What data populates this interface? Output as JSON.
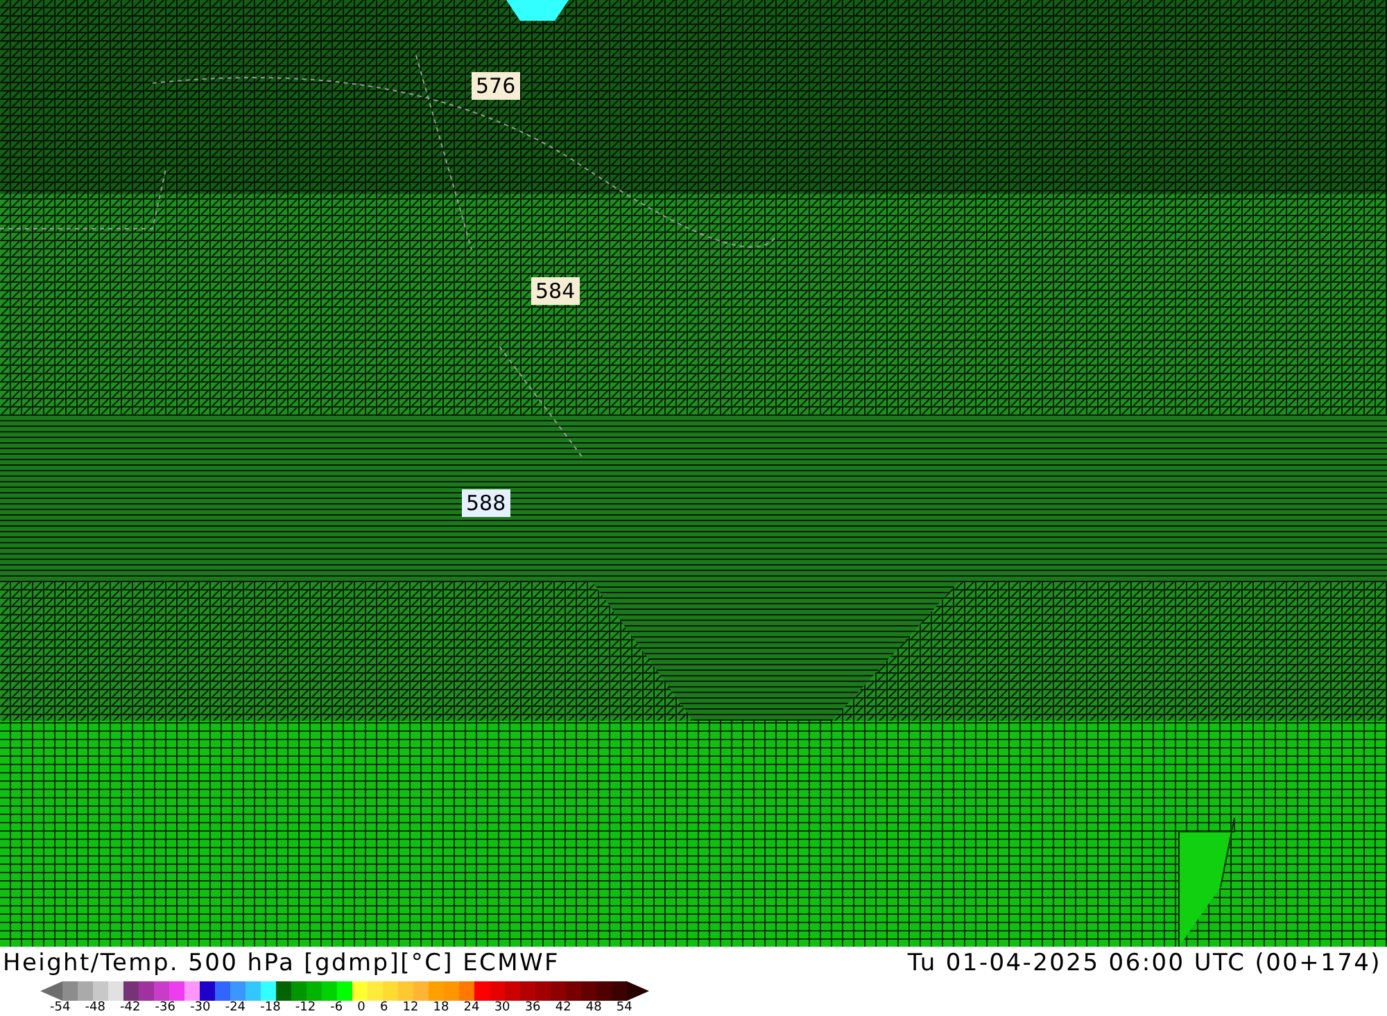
{
  "map": {
    "contour_labels": [
      {
        "text": "576",
        "color": "#f5eed5"
      },
      {
        "text": "584",
        "color": "#f5eed5"
      },
      {
        "text": "588",
        "color": "#e6f0ff"
      }
    ]
  },
  "title": "Height/Temp. 500 hPa [gdmp][°C] ECMWF",
  "valid_time": "Tu 01-04-2025 06:00 UTC (00+174)",
  "legend": {
    "swatches": [
      {
        "kind": "low",
        "color": "#6e6e6e"
      },
      {
        "color": "#8c8c8c"
      },
      {
        "color": "#aaaaaa"
      },
      {
        "color": "#c8c8c8"
      },
      {
        "color": "#e1e1e1"
      },
      {
        "color": "#783278"
      },
      {
        "color": "#a032a0"
      },
      {
        "color": "#c83cc8"
      },
      {
        "color": "#f03cf0"
      },
      {
        "color": "#ff96ff"
      },
      {
        "color": "#1e00c8"
      },
      {
        "color": "#3264ff"
      },
      {
        "color": "#3c96ff"
      },
      {
        "color": "#32c8ff"
      },
      {
        "color": "#32ffff"
      },
      {
        "color": "#006400"
      },
      {
        "color": "#009600"
      },
      {
        "color": "#00b400"
      },
      {
        "color": "#00d200"
      },
      {
        "color": "#00ff00"
      },
      {
        "color": "#ffff32"
      },
      {
        "color": "#ffeb3c"
      },
      {
        "color": "#ffdc32"
      },
      {
        "color": "#ffc832"
      },
      {
        "color": "#ffb432"
      },
      {
        "color": "#ffa000"
      },
      {
        "color": "#ff9600"
      },
      {
        "color": "#ff7800"
      },
      {
        "color": "#ff0000"
      },
      {
        "color": "#e60000"
      },
      {
        "color": "#cd0000"
      },
      {
        "color": "#b40000"
      },
      {
        "color": "#a00000"
      },
      {
        "color": "#8c0000"
      },
      {
        "color": "#780000"
      },
      {
        "color": "#640000"
      },
      {
        "color": "#500000"
      },
      {
        "color": "#3c0000"
      },
      {
        "kind": "high",
        "color": "#280000"
      }
    ],
    "ticks": [
      "-54",
      "-48",
      "-42",
      "-36",
      "-30",
      "-24",
      "-18",
      "-12",
      "-6",
      "0",
      "6",
      "12",
      "18",
      "24",
      "30",
      "36",
      "42",
      "48",
      "54"
    ]
  }
}
